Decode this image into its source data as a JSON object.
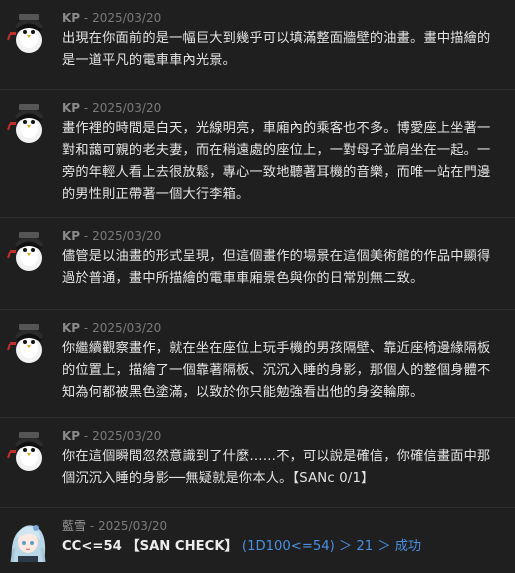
{
  "messages": [
    {
      "author": "KP",
      "sep": " - ",
      "date": "2025/03/20",
      "avatar_icon": "penguin-avatar-icon",
      "text": "出現在你面前的是一幅巨大到幾乎可以填滿整面牆壁的油畫。畫中描繪的是一道平凡的電車車內光景。"
    },
    {
      "author": "KP",
      "sep": " - ",
      "date": "2025/03/20",
      "avatar_icon": "penguin-avatar-icon",
      "text": "畫作裡的時間是白天，光線明亮，車廂內的乘客也不多。博愛座上坐著一對和藹可親的老夫妻，而在稍遠處的座位上，一對母子並肩坐在一起。一旁的年輕人看上去很放鬆，專心一致地聽著耳機的音樂，而唯一站在門邊的男性則正帶著一個大行李箱。"
    },
    {
      "author": "KP",
      "sep": " - ",
      "date": "2025/03/20",
      "avatar_icon": "penguin-avatar-icon",
      "text": "儘管是以油畫的形式呈現，但這個畫作的場景在這個美術館的作品中顯得過於普通，畫中所描繪的電車車廂景色與你的日常別無二致。"
    },
    {
      "author": "KP",
      "sep": " - ",
      "date": "2025/03/20",
      "avatar_icon": "penguin-avatar-icon",
      "text": "你繼續觀察畫作，就在坐在座位上玩手機的男孩隔壁、靠近座椅邊緣隔板的位置上，描繪了一個靠著隔板、沉沉入睡的身影，那個人的整個身體不知為何都被黑色塗滿，以致於你只能勉強看出他的身姿輪廓。"
    },
    {
      "author": "KP",
      "sep": " - ",
      "date": "2025/03/20",
      "avatar_icon": "penguin-avatar-icon",
      "text": "你在這個瞬間忽然意識到了什麼……不，可以說是確信，你確信畫面中那個沉沉入睡的身影──無疑就是你本人。【SANc 0/1】"
    },
    {
      "author": "藍雪",
      "sep": " - ",
      "date": "2025/03/20",
      "avatar_icon": "anime-girl-avatar-icon",
      "roll_main": "CC<=54 【SAN CHECK】",
      "roll_detail": " (1D100<=54) ＞ 21 ＞ 成功"
    }
  ],
  "colors": {
    "background": "#1f1f1f",
    "text": "#e4e4e4",
    "meta": "#7b7b7b",
    "roll_detail": "#4a90e2"
  }
}
